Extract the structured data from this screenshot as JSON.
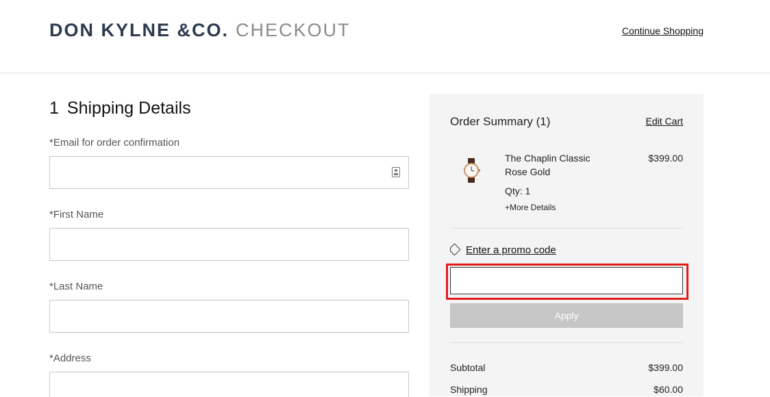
{
  "header": {
    "brand_name": "DON KYLNE &CO.",
    "brand_sub": "CHECKOUT",
    "continue_label": "Continue Shopping"
  },
  "shipping": {
    "step_number": "1",
    "step_title": "Shipping Details",
    "email_label": "*Email for order confirmation",
    "first_name_label": "*First Name",
    "last_name_label": "*Last Name",
    "address_label": "*Address"
  },
  "summary": {
    "title": "Order Summary (1)",
    "edit_cart": "Edit Cart",
    "item": {
      "name": "The Chaplin Classic Rose Gold",
      "price": "$399.00",
      "qty": "Qty: 1",
      "more": "+More Details"
    },
    "promo_label": "Enter a promo code",
    "apply_label": "Apply",
    "subtotal_label": "Subtotal",
    "subtotal_value": "$399.00",
    "shipping_label": "Shipping",
    "shipping_value": "$60.00"
  },
  "colors": {
    "brand": "#2c3a4f",
    "summary_bg": "#f4f4f4",
    "apply_disabled": "#c6c6c6",
    "highlight": "#e01b1b"
  },
  "icons": [
    "contact-card-icon",
    "tag-icon",
    "watch-thumbnail"
  ]
}
